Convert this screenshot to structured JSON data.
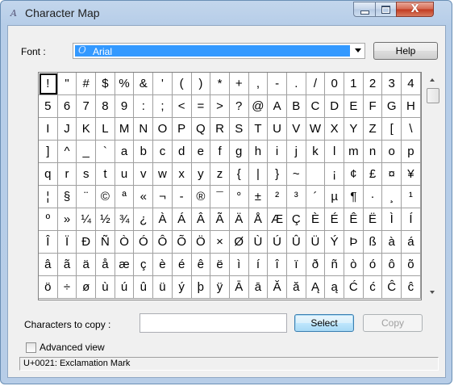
{
  "window": {
    "title": "Character Map",
    "minimize_label": "",
    "maximize_label": "",
    "close_label": "X"
  },
  "font": {
    "label": "Font :",
    "value": "Arial"
  },
  "help_label": "Help",
  "characters": [
    "!",
    "\"",
    "#",
    "$",
    "%",
    "&",
    "'",
    "(",
    ")",
    "*",
    "+",
    ",",
    "-",
    ".",
    "/",
    "0",
    "1",
    "2",
    "3",
    "4",
    "5",
    "6",
    "7",
    "8",
    "9",
    ":",
    ";",
    "<",
    "=",
    ">",
    "?",
    "@",
    "A",
    "B",
    "C",
    "D",
    "E",
    "F",
    "G",
    "H",
    "I",
    "J",
    "K",
    "L",
    "M",
    "N",
    "O",
    "P",
    "Q",
    "R",
    "S",
    "T",
    "U",
    "V",
    "W",
    "X",
    "Y",
    "Z",
    "[",
    "\\",
    "]",
    "^",
    "_",
    "`",
    "a",
    "b",
    "c",
    "d",
    "e",
    "f",
    "g",
    "h",
    "i",
    "j",
    "k",
    "l",
    "m",
    "n",
    "o",
    "p",
    "q",
    "r",
    "s",
    "t",
    "u",
    "v",
    "w",
    "x",
    "y",
    "z",
    "{",
    "|",
    "}",
    "~",
    " ",
    "¡",
    "¢",
    "£",
    "¤",
    "¥",
    "¦",
    "§",
    "¨",
    "©",
    "ª",
    "«",
    "¬",
    "-",
    "®",
    "¯",
    "°",
    "±",
    "²",
    "³",
    "´",
    "µ",
    "¶",
    "·",
    "¸",
    "¹",
    "º",
    "»",
    "¼",
    "½",
    "¾",
    "¿",
    "À",
    "Á",
    "Â",
    "Ã",
    "Ä",
    "Å",
    "Æ",
    "Ç",
    "È",
    "É",
    "Ê",
    "Ë",
    "Ì",
    "Í",
    "Î",
    "Ï",
    "Ð",
    "Ñ",
    "Ò",
    "Ó",
    "Ô",
    "Õ",
    "Ö",
    "×",
    "Ø",
    "Ù",
    "Ú",
    "Û",
    "Ü",
    "Ý",
    "Þ",
    "ß",
    "à",
    "á",
    "â",
    "ã",
    "ä",
    "å",
    "æ",
    "ç",
    "è",
    "é",
    "ê",
    "ë",
    "ì",
    "í",
    "î",
    "ï",
    "ð",
    "ñ",
    "ò",
    "ó",
    "ô",
    "õ",
    "ö",
    "÷",
    "ø",
    "ù",
    "ú",
    "û",
    "ü",
    "ý",
    "þ",
    "ÿ",
    "Ā",
    "ā",
    "Ă",
    "ă",
    "Ą",
    "ą",
    "Ć",
    "ć",
    "Ĉ",
    "ĉ"
  ],
  "selected_index": 0,
  "copy": {
    "label": "Characters to copy :",
    "value": "",
    "select_label": "Select",
    "copy_label": "Copy"
  },
  "advanced_view": {
    "label": "Advanced view",
    "checked": false
  },
  "status": "U+0021: Exclamation Mark"
}
